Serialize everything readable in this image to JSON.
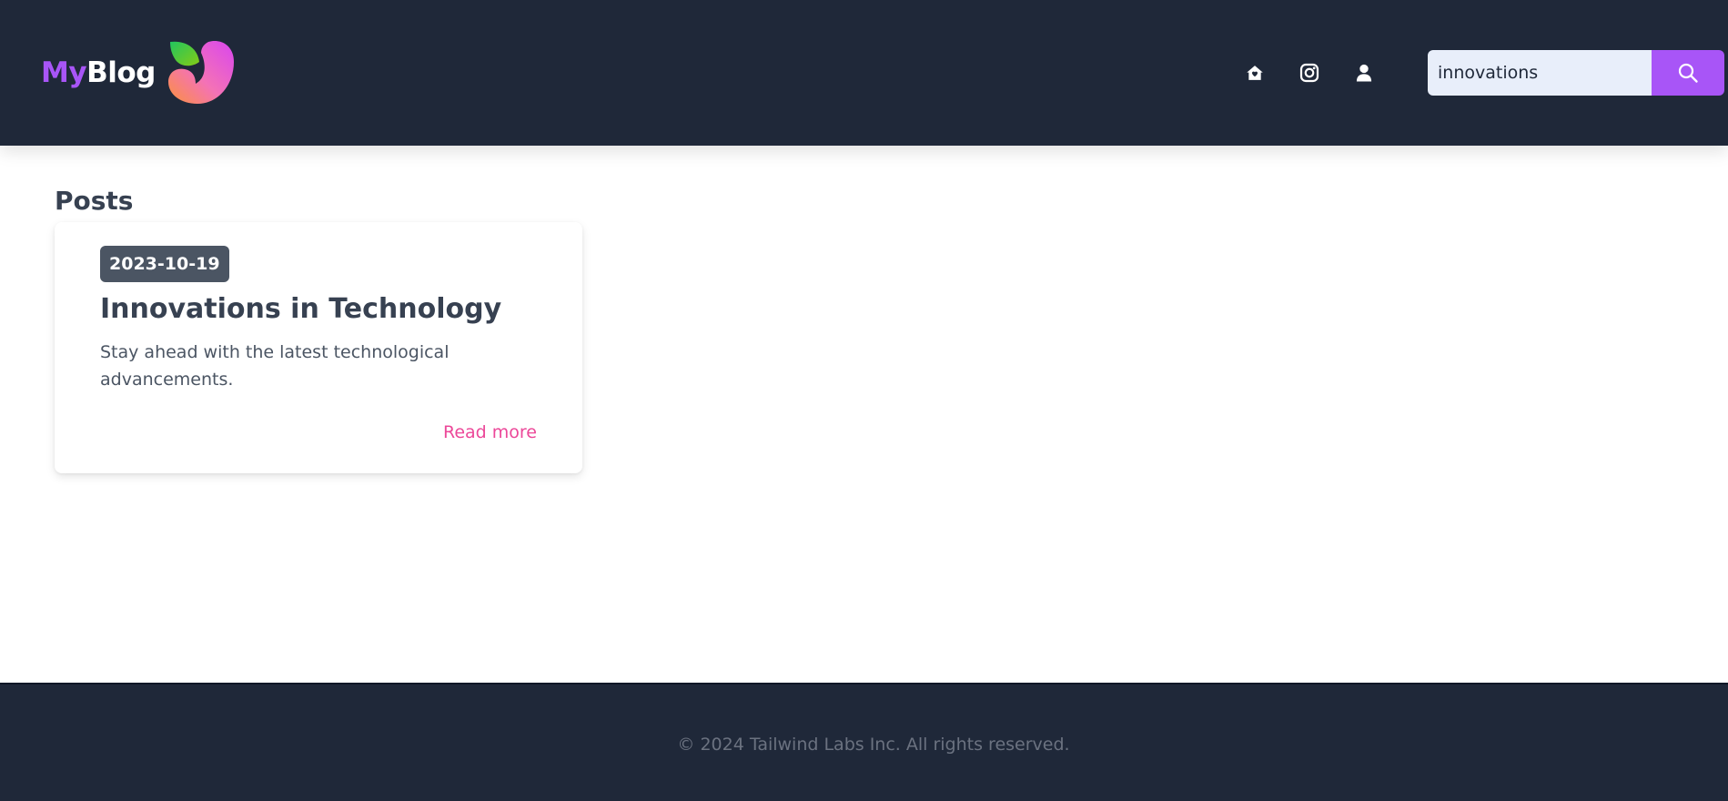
{
  "header": {
    "logo": {
      "part1": "My",
      "part2": "Blog"
    },
    "nav": [
      {
        "icon": "home-icon"
      },
      {
        "icon": "instagram-icon"
      },
      {
        "icon": "user-icon"
      }
    ],
    "search": {
      "value": "innovations",
      "button_icon": "search-icon"
    }
  },
  "main": {
    "section_title": "Posts",
    "posts": [
      {
        "date": "2023-10-19",
        "title": "Innovations in Technology",
        "excerpt": "Stay ahead with the latest technological advancements.",
        "link_label": "Read more"
      }
    ]
  },
  "footer": {
    "text": "© 2024 Tailwind Labs Inc. All rights reserved."
  },
  "colors": {
    "header_bg": "#1f2839",
    "accent": "#a855f7",
    "link": "#ec4899",
    "badge_bg": "#4b5563"
  }
}
